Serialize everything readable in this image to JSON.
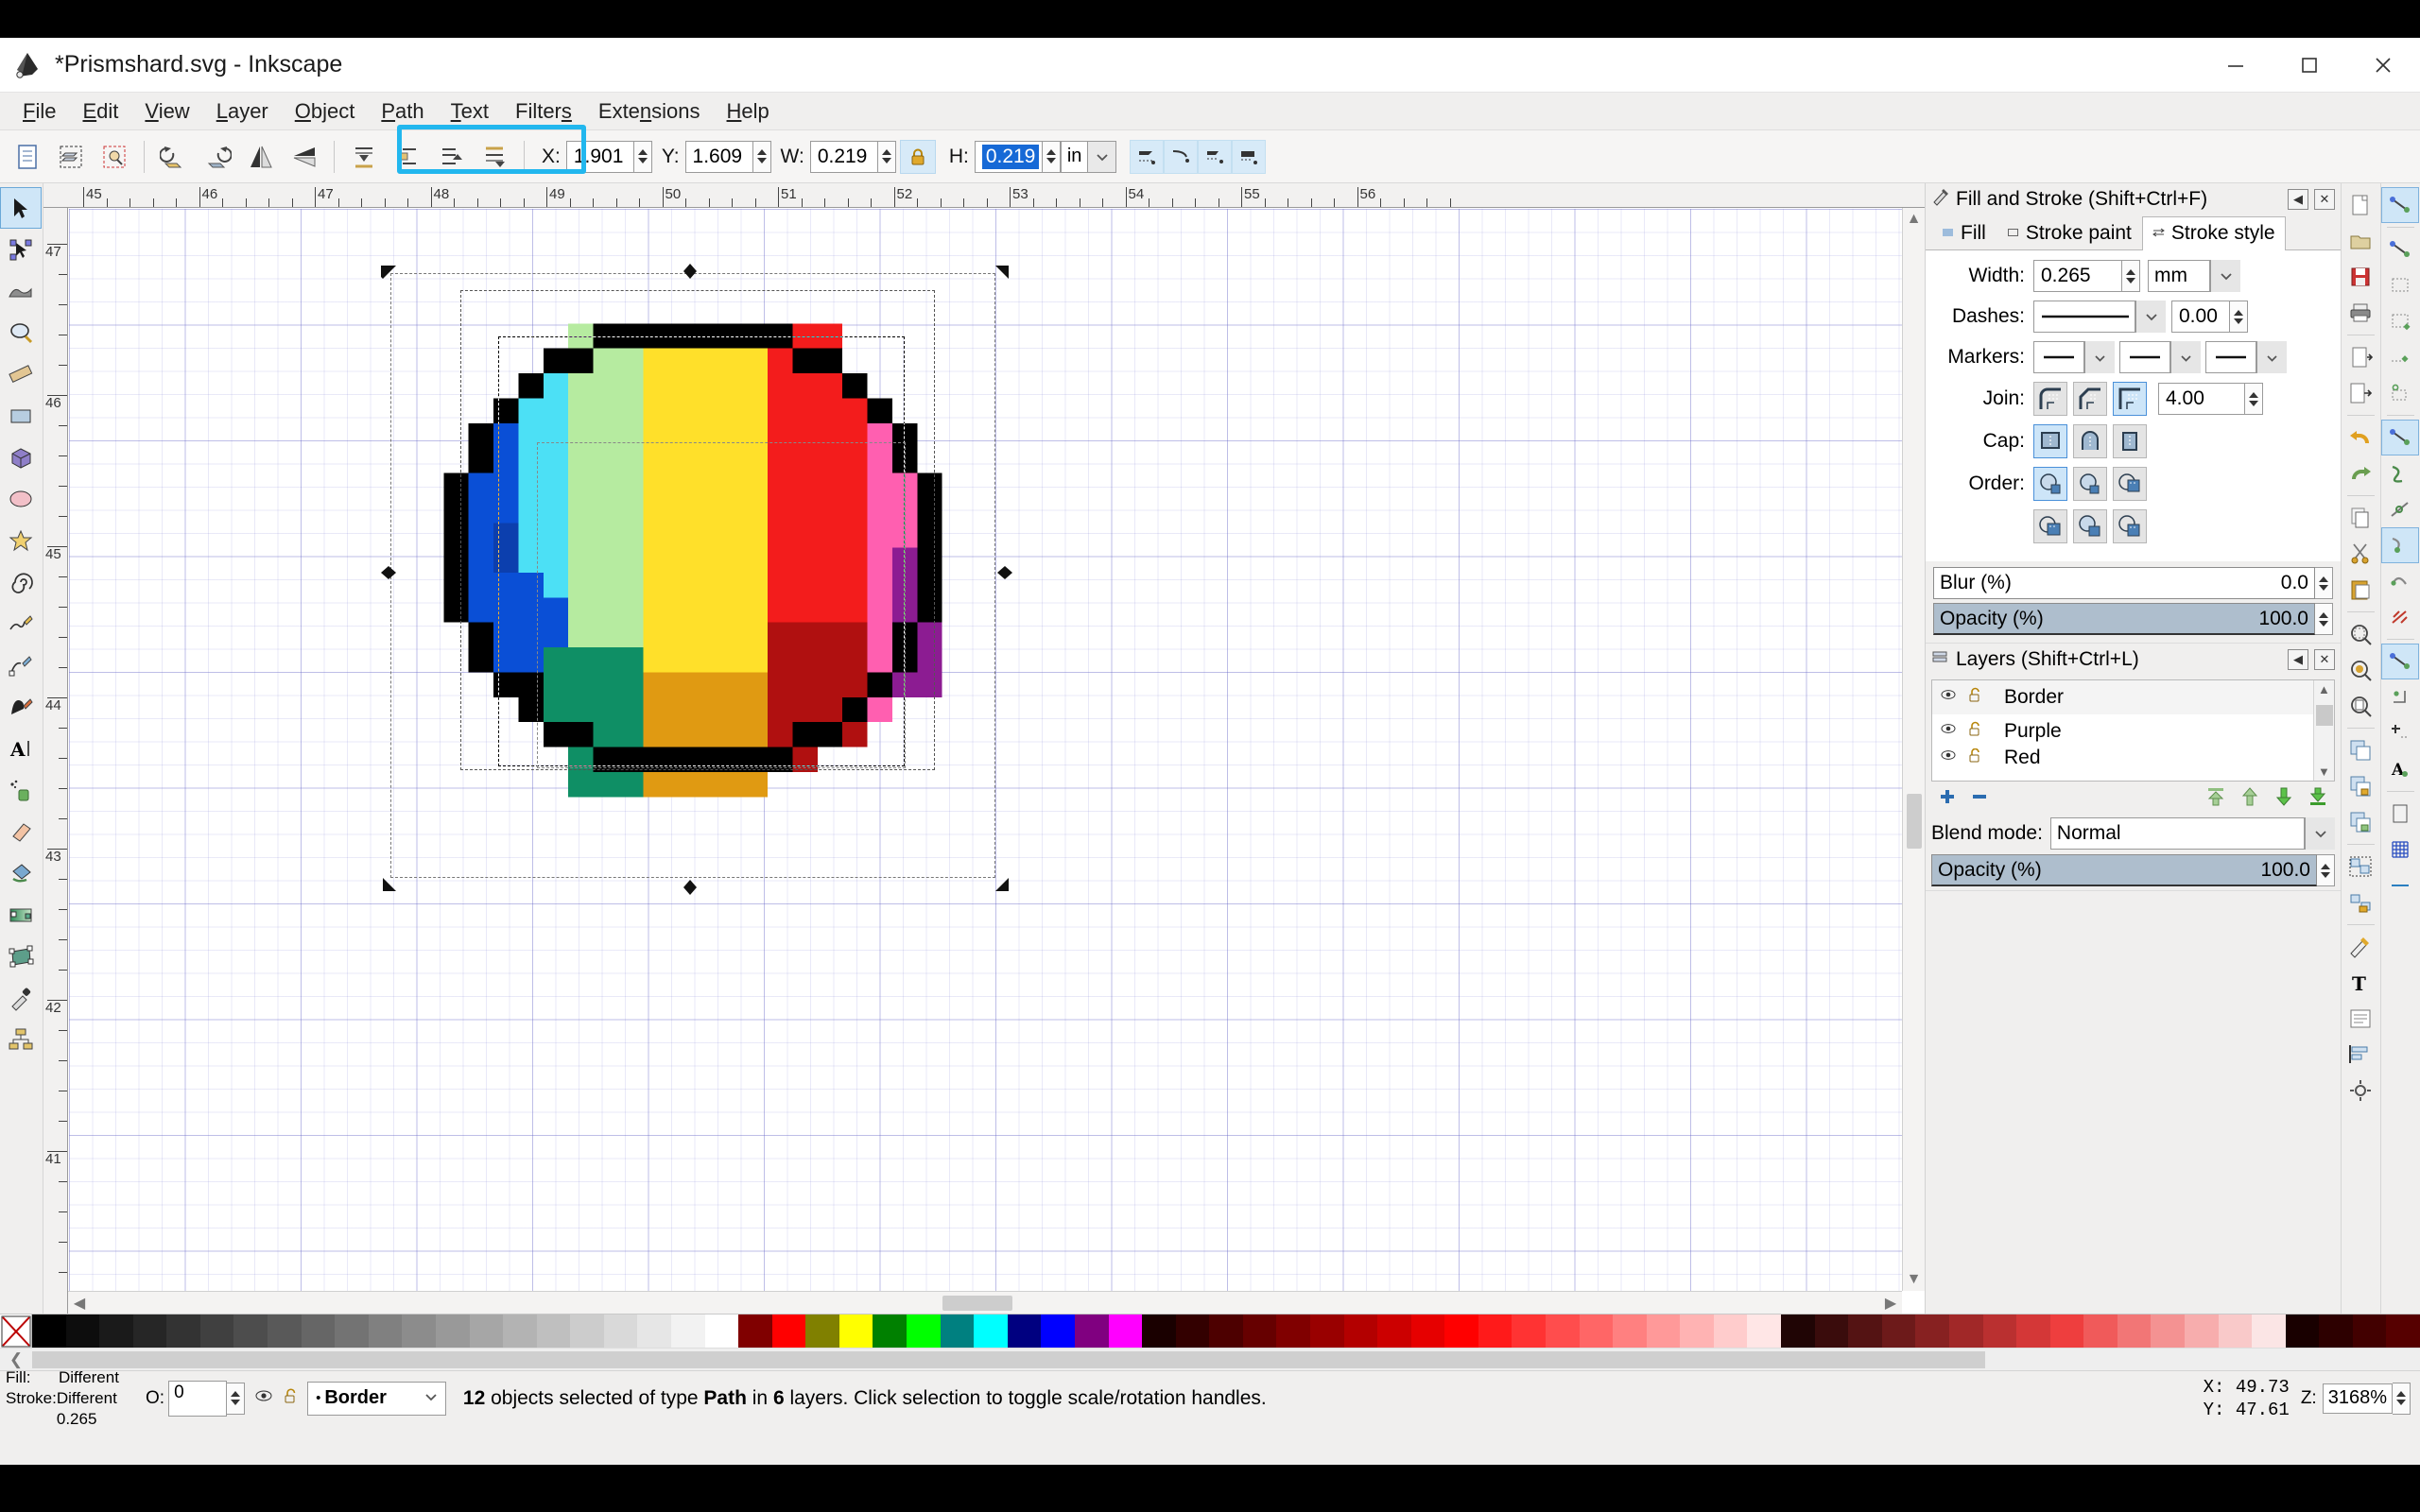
{
  "window": {
    "title": "*Prismshard.svg - Inkscape",
    "app_icon": "inkscape-logo-icon",
    "minimize": "minimize-icon",
    "maximize": "maximize-icon",
    "close": "close-icon"
  },
  "menubar": {
    "items": [
      {
        "label": "File",
        "accel": "F"
      },
      {
        "label": "Edit",
        "accel": "E"
      },
      {
        "label": "View",
        "accel": "V"
      },
      {
        "label": "Layer",
        "accel": "L"
      },
      {
        "label": "Object",
        "accel": "O"
      },
      {
        "label": "Path",
        "accel": "P"
      },
      {
        "label": "Text",
        "accel": "T"
      },
      {
        "label": "Filters",
        "accel": "s"
      },
      {
        "label": "Extensions",
        "accel": "n"
      },
      {
        "label": "Help",
        "accel": "H"
      }
    ]
  },
  "toolbar": {
    "buttons": [
      "select-all-icon",
      "select-all-in-layers-icon",
      "deselect-icon",
      "rotate-ccw-icon",
      "rotate-cw-icon",
      "flip-horizontal-icon",
      "flip-vertical-icon",
      "lower-to-bottom-icon",
      "lower-icon",
      "raise-icon",
      "raise-to-top-icon"
    ],
    "x_label": "X:",
    "x_value": "1.901",
    "y_label": "Y:",
    "y_value": "1.609",
    "w_label": "W:",
    "w_value": "0.219",
    "lock_icon": "lock-closed-icon",
    "h_label": "H:",
    "h_value": "0.219",
    "unit": "in",
    "affect_buttons": [
      "affect-stroke-width-icon",
      "affect-rounded-corners-icon",
      "affect-gradients-icon",
      "affect-patterns-icon"
    ]
  },
  "toolbox": {
    "tools": [
      {
        "name": "selector-tool",
        "active": true
      },
      {
        "name": "node-tool",
        "active": false
      },
      {
        "name": "tweak-tool",
        "active": false
      },
      {
        "name": "zoom-tool",
        "active": false
      },
      {
        "name": "measure-tool",
        "active": false
      },
      {
        "name": "rectangle-tool",
        "active": false
      },
      {
        "name": "box3d-tool",
        "active": false
      },
      {
        "name": "ellipse-tool",
        "active": false
      },
      {
        "name": "star-tool",
        "active": false
      },
      {
        "name": "spiral-tool",
        "active": false
      },
      {
        "name": "pencil-tool",
        "active": false
      },
      {
        "name": "bezier-tool",
        "active": false
      },
      {
        "name": "calligraphy-tool",
        "active": false
      },
      {
        "name": "text-tool",
        "active": false
      },
      {
        "name": "spray-tool",
        "active": false
      },
      {
        "name": "eraser-tool",
        "active": false
      },
      {
        "name": "paint-bucket-tool",
        "active": false
      },
      {
        "name": "gradient-tool",
        "active": false
      },
      {
        "name": "mesh-tool",
        "active": false
      },
      {
        "name": "dropper-tool",
        "active": false
      },
      {
        "name": "connector-tool",
        "active": false
      }
    ]
  },
  "rulers": {
    "unit_hint": "mm",
    "horizontal_labels": [
      "45",
      "46",
      "47",
      "48",
      "49",
      "50",
      "51",
      "52",
      "53",
      "54",
      "55",
      "56"
    ],
    "vertical_labels": [
      "47",
      "46",
      "45",
      "44",
      "43",
      "42",
      "41"
    ]
  },
  "canvas": {
    "artwork_name": "pixel-gem-sprite",
    "grid_visible": true,
    "selection_markers": "scale-arrows",
    "gem_colors": {
      "border": "#000000",
      "blue": "#0a4fd6",
      "blue_dark": "#0c3fae",
      "cyan": "#4ce0f5",
      "light_green": "#b6eba0",
      "yellow": "#ffe02a",
      "red": "#f31c1c",
      "pink": "#ff5fb0",
      "purple": "#8c1c92",
      "dark_red": "#b01010",
      "orange": "#e09a12",
      "teal_green": "#0f8f65"
    }
  },
  "fill_and_stroke": {
    "title": "Fill and Stroke (Shift+Ctrl+F)",
    "panel_icon": "fill-stroke-icon",
    "collapse_icon": "collapse-icon",
    "close_icon": "close-panel-icon",
    "tabs": [
      {
        "label": "Fill",
        "icon": "fill-swatch-icon",
        "active": false
      },
      {
        "label": "Stroke paint",
        "icon": "stroke-paint-icon",
        "active": false
      },
      {
        "label": "Stroke style",
        "icon": "stroke-style-icon",
        "active": true
      }
    ],
    "width_label": "Width:",
    "width_value": "0.265",
    "width_unit": "mm",
    "dashes_label": "Dashes:",
    "dashes_pattern": "solid-line",
    "dashes_offset": "0.00",
    "markers_label": "Markers:",
    "markers": [
      "none-marker",
      "none-marker",
      "none-marker"
    ],
    "join_label": "Join:",
    "join_options": [
      "round-join-icon",
      "bevel-join-icon",
      "miter-join-icon"
    ],
    "join_selected_index": 2,
    "miter_limit": "4.00",
    "cap_label": "Cap:",
    "cap_options": [
      "butt-cap-icon",
      "round-cap-icon",
      "square-cap-icon"
    ],
    "cap_selected_index": 0,
    "order_label": "Order:",
    "order_options": [
      "fill-stroke-markers-icon",
      "fill-markers-stroke-icon",
      "stroke-fill-markers-icon",
      "stroke-markers-fill-icon",
      "markers-fill-stroke-icon",
      "markers-stroke-fill-icon"
    ],
    "order_selected_index": 0,
    "blur_label": "Blur (%)",
    "blur_value": "0.0",
    "opacity_label": "Opacity (%)",
    "opacity_value": "100.0"
  },
  "layers_panel": {
    "title": "Layers (Shift+Ctrl+L)",
    "panel_icon": "layers-icon",
    "collapse_icon": "collapse-icon",
    "close_icon": "close-panel-icon",
    "layers": [
      {
        "name": "Border",
        "visible_icon": "eye-icon",
        "lock_icon": "unlock-icon"
      },
      {
        "name": "Purple",
        "visible_icon": "eye-icon",
        "lock_icon": "unlock-icon"
      },
      {
        "name": "Red",
        "visible_icon": "eye-icon",
        "lock_icon": "unlock-icon"
      }
    ],
    "add_layer_icon": "plus-icon",
    "remove_layer_icon": "minus-icon",
    "raise_top_icon": "raise-to-top-icon",
    "raise_icon": "raise-icon",
    "lower_icon": "lower-icon",
    "lower_bottom_icon": "lower-to-bottom-icon",
    "blend_mode_label": "Blend mode:",
    "blend_mode_value": "Normal",
    "opacity_label": "Opacity (%)",
    "opacity_value": "100.0"
  },
  "command_bar": {
    "buttons": [
      "new-document-icon",
      "open-document-icon",
      "save-document-icon",
      "print-icon",
      "import-icon",
      "export-icon",
      "undo-icon",
      "redo-icon",
      "copy-icon",
      "cut-icon",
      "paste-icon",
      "zoom-selection-icon",
      "zoom-drawing-icon",
      "zoom-page-icon",
      "duplicate-icon",
      "clone-icon",
      "unlink-clone-icon",
      "group-icon",
      "ungroup-icon",
      "fill-stroke-icon",
      "text-properties-icon",
      "xml-editor-icon",
      "align-distribute-icon",
      "preferences-icon"
    ]
  },
  "snap_bar": {
    "buttons": [
      {
        "name": "enable-snapping-icon",
        "selected": true
      },
      {
        "name": "snap-bounding-boxes-icon",
        "selected": false
      },
      {
        "name": "snap-bbox-edges-icon",
        "selected": false
      },
      {
        "name": "snap-bbox-corners-icon",
        "selected": false
      },
      {
        "name": "snap-bbox-edge-midpoints-icon",
        "selected": false
      },
      {
        "name": "snap-bbox-centers-icon",
        "selected": false
      },
      {
        "name": "snap-nodes-icon",
        "selected": true
      },
      {
        "name": "snap-paths-icon",
        "selected": false
      },
      {
        "name": "snap-path-intersections-icon",
        "selected": false
      },
      {
        "name": "snap-cusp-nodes-icon",
        "selected": true
      },
      {
        "name": "snap-smooth-nodes-icon",
        "selected": false
      },
      {
        "name": "snap-midpoints-icon",
        "selected": false
      },
      {
        "name": "snap-others-icon",
        "selected": true
      },
      {
        "name": "snap-object-centers-icon",
        "selected": false
      },
      {
        "name": "snap-rotation-centers-icon",
        "selected": false
      },
      {
        "name": "snap-text-baselines-icon",
        "selected": false
      },
      {
        "name": "snap-page-border-icon",
        "selected": false
      },
      {
        "name": "snap-grids-icon",
        "selected": false
      },
      {
        "name": "snap-guides-icon",
        "selected": false
      }
    ]
  },
  "palette": {
    "none_swatch": "no-color-icon",
    "swatches": [
      "#000000",
      "#0d0d0d",
      "#1a1a1a",
      "#262626",
      "#333333",
      "#404040",
      "#4d4d4d",
      "#595959",
      "#666666",
      "#737373",
      "#808080",
      "#8c8c8c",
      "#999999",
      "#a6a6a6",
      "#b3b3b3",
      "#bfbfbf",
      "#cccccc",
      "#d9d9d9",
      "#e6e6e6",
      "#f2f2f2",
      "#ffffff",
      "#800000",
      "#ff0000",
      "#808000",
      "#ffff00",
      "#008000",
      "#00ff00",
      "#008080",
      "#00ffff",
      "#000080",
      "#0000ff",
      "#800080",
      "#ff00ff",
      "#1a0000",
      "#330000",
      "#4d0000",
      "#660000",
      "#800000",
      "#990000",
      "#b30000",
      "#cc0000",
      "#e60000",
      "#ff0000",
      "#ff1a1a",
      "#ff3333",
      "#ff4d4d",
      "#ff6666",
      "#ff8080",
      "#ff9999",
      "#ffb3b3",
      "#ffcccc",
      "#ffe6e6",
      "#200505",
      "#3a0c0c",
      "#541313",
      "#6d1a1a",
      "#872121",
      "#a12828",
      "#ba3030",
      "#d43737",
      "#ee3e3e",
      "#f05a5a",
      "#f27676",
      "#f49292",
      "#f7adad",
      "#f9c9c9",
      "#fbe5e5",
      "#190000",
      "#2d0000",
      "#420000",
      "#560000"
    ],
    "scroll_left_icon": "chevron-left-icon"
  },
  "statusbar": {
    "fill_label": "Fill:",
    "fill_value": "Different",
    "stroke_label": "Stroke:",
    "stroke_value": "Different 0.265",
    "opacity_label": "O:",
    "opacity_value": "0",
    "eye_icon": "eye-icon",
    "lock_icon": "unlock-icon",
    "current_layer": "Border",
    "message": "12 objects selected of type Path in 6 layers. Click selection to toggle scale/rotation handles.",
    "message_parts": {
      "count": "12",
      "mid1": " objects selected of type ",
      "type": "Path",
      "mid2": " in ",
      "layers": "6",
      "tail": " layers. Click selection to toggle scale/rotation handles."
    },
    "x_label": "X:",
    "x_value": "49.73",
    "y_label": "Y:",
    "y_value": "47.61",
    "zoom_label": "Z:",
    "zoom_value": "3168%"
  }
}
